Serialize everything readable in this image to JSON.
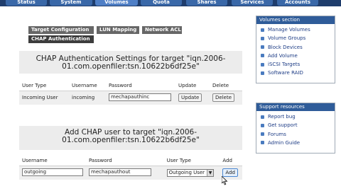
{
  "nav": {
    "tabs": [
      {
        "label": "Status"
      },
      {
        "label": "System"
      },
      {
        "label": "Volumes"
      },
      {
        "label": "Quota"
      },
      {
        "label": "Shares"
      },
      {
        "label": "Services"
      },
      {
        "label": "Accounts"
      }
    ],
    "active_index": 2
  },
  "subtabs": [
    {
      "label": "Target Configuration"
    },
    {
      "label": "LUN Mapping"
    },
    {
      "label": "Network ACL"
    },
    {
      "label": "CHAP Authentication"
    }
  ],
  "chap_settings": {
    "title": "CHAP Authentication Settings for target \"iqn.2006-01.com.openfiler:tsn.10622b6df25e\"",
    "columns": [
      "User Type",
      "Username",
      "Password",
      "Update",
      "Delete"
    ],
    "row": {
      "user_type": "Incoming User",
      "username": "incoming",
      "password": "mechapauthinc",
      "update_label": "Update",
      "delete_label": "Delete"
    }
  },
  "add_user": {
    "title": "Add CHAP user to target \"iqn.2006-01.com.openfiler:tsn.10622b6df25e\"",
    "columns": [
      "Username",
      "Password",
      "User Type",
      "Add"
    ],
    "row": {
      "username": "outgoing",
      "password": "mechapauthout",
      "user_type": "Outgoing User",
      "add_label": "Add"
    }
  },
  "sidebar": {
    "volumes": {
      "title": "Volumes section",
      "items": [
        {
          "label": "Manage Volumes"
        },
        {
          "label": "Volume Groups"
        },
        {
          "label": "Block Devices"
        },
        {
          "label": "Add Volume"
        },
        {
          "label": "iSCSI Targets"
        },
        {
          "label": "Software RAID"
        }
      ]
    },
    "support": {
      "title": "Support resources",
      "items": [
        {
          "label": "Report bug"
        },
        {
          "label": "Get support"
        },
        {
          "label": "Forums"
        },
        {
          "label": "Admin Guide"
        }
      ]
    }
  }
}
